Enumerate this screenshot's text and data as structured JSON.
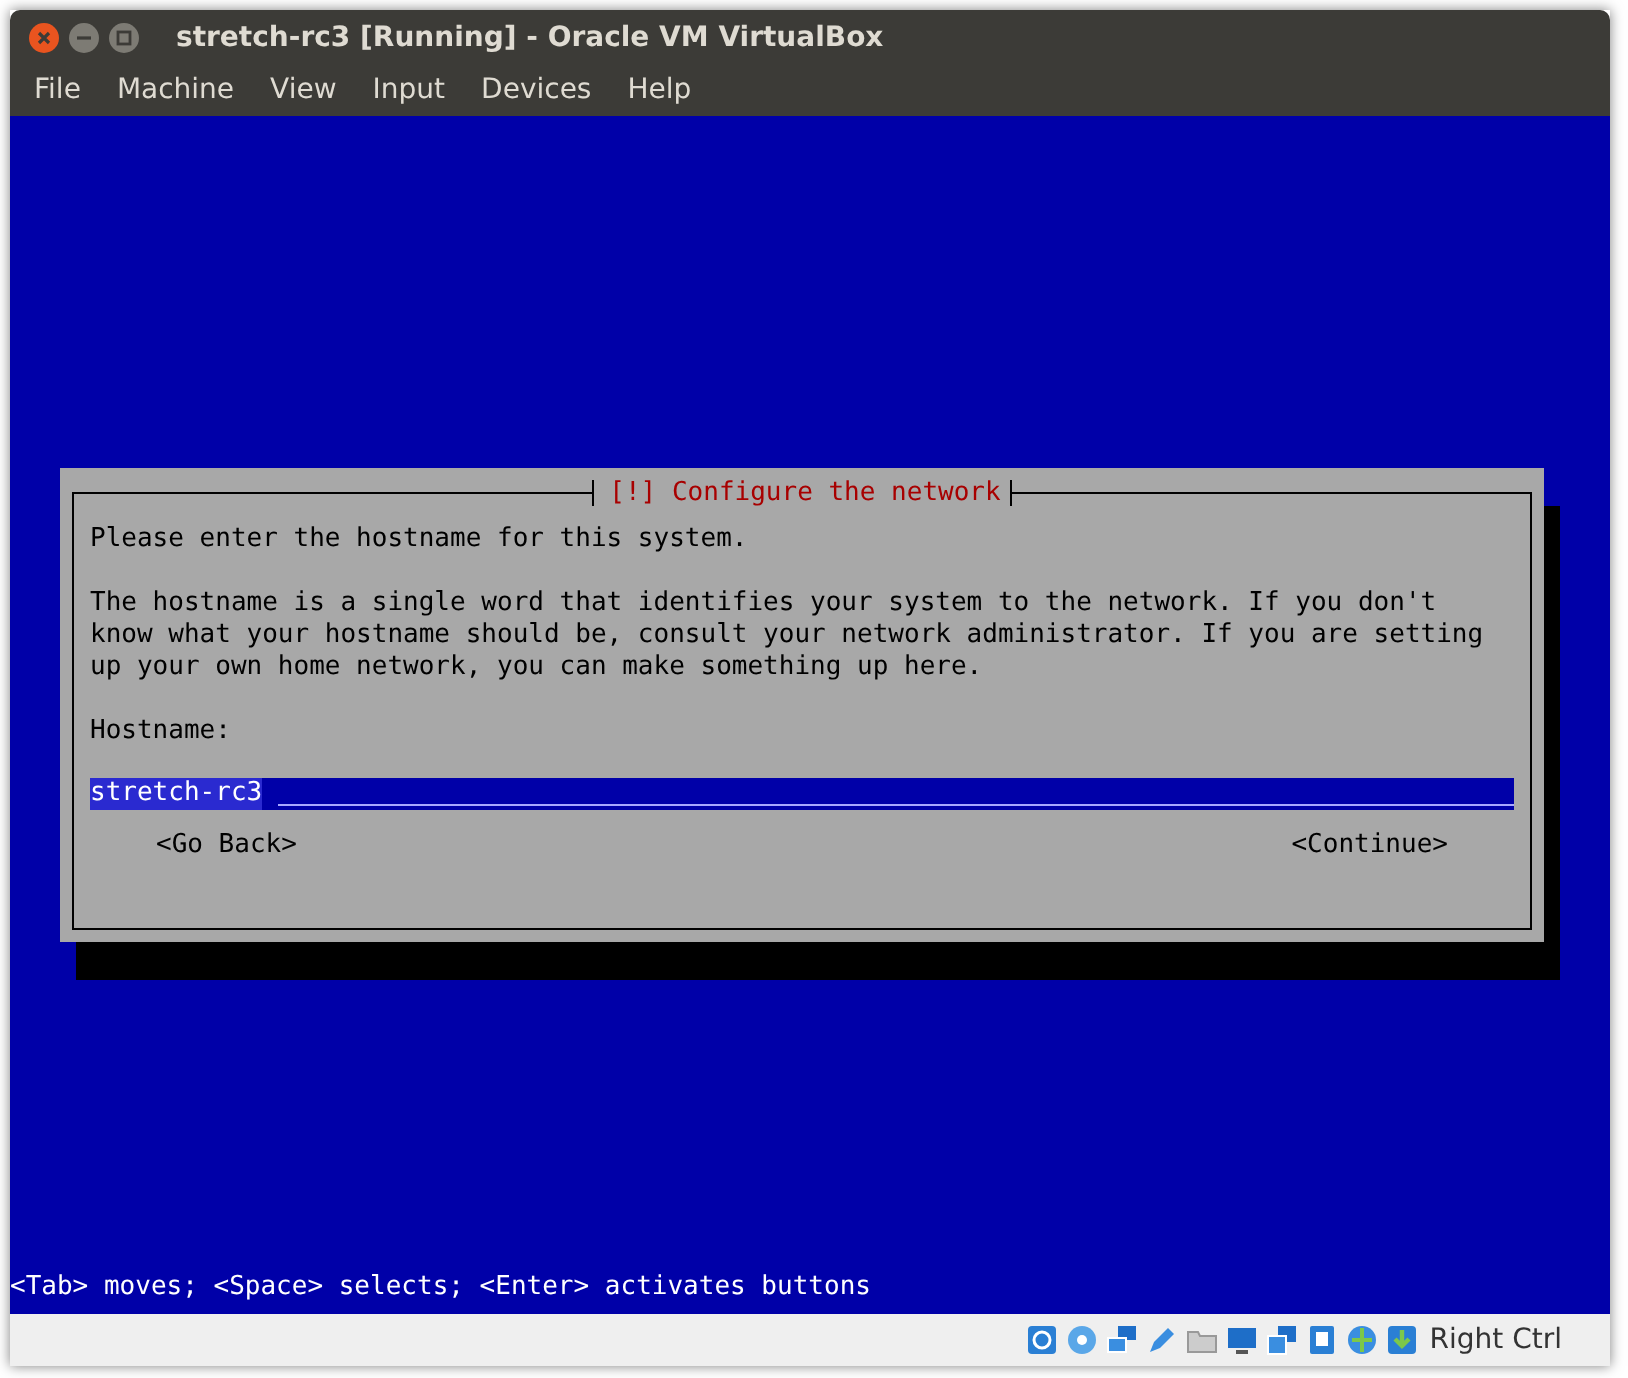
{
  "window": {
    "title": "stretch-rc3 [Running] - Oracle VM VirtualBox"
  },
  "menu": [
    "File",
    "Machine",
    "View",
    "Input",
    "Devices",
    "Help"
  ],
  "dialog": {
    "title": "[!] Configure the network",
    "paragraphs": [
      "Please enter the hostname for this system.",
      "The hostname is a single word that identifies your system to the network. If you don't know what your hostname should be, consult your network administrator. If you are setting up your own home network, you can make something up here."
    ],
    "field": {
      "label": "Hostname:",
      "value": "stretch-rc3",
      "focused": true
    },
    "buttons": [
      {
        "label": "<Go Back>",
        "selected": false
      },
      {
        "label": "<Continue>",
        "selected": false
      }
    ]
  },
  "hint": "<Tab> moves; <Space> selects; <Enter> activates buttons",
  "status_bar": {
    "host_key": "Right Ctrl"
  }
}
